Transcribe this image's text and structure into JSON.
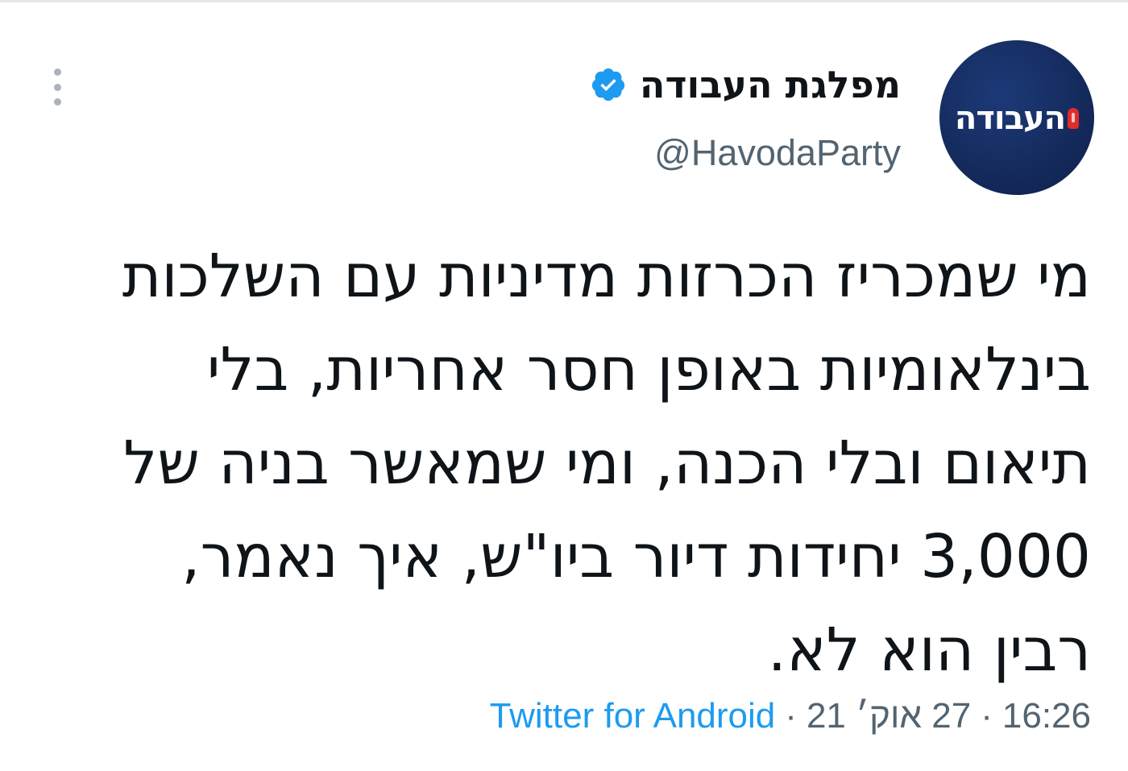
{
  "author": {
    "display_name": "מפלגת העבודה",
    "handle": "@HavodaParty",
    "verified": true,
    "avatar_text": "העבודה",
    "avatar_bg": "#142a5c",
    "verified_color": "#1d9bf0"
  },
  "tweet": {
    "text": "מי שמכריז הכרזות מדיניות עם השלכות\nבינלאומיות באופן חסר אחריות, בלי\nתיאום ובלי הכנה, ומי שמאשר בניה של\n3,000 יחידות דיור ביו\"ש, איך נאמר,\nרבין הוא לא."
  },
  "meta": {
    "time": "16:26",
    "separator": "·",
    "date": "27 אוק׳ 21",
    "source": "Twitter for Android"
  },
  "icons": {
    "more": "more-vertical-icon",
    "verified": "verified-badge-icon",
    "avatar_logo": "rose-icon"
  }
}
